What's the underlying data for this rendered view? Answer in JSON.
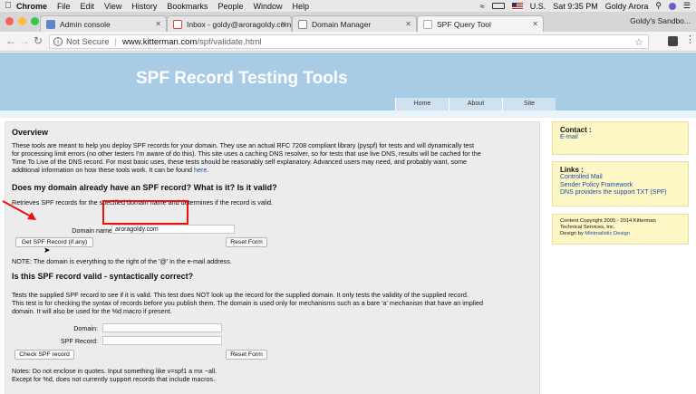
{
  "menubar": {
    "app": "Chrome",
    "menus": [
      "File",
      "Edit",
      "View",
      "History",
      "Bookmarks",
      "People",
      "Window",
      "Help"
    ],
    "input_source": "U.S.",
    "clock": "Sat 9:35 PM",
    "user": "Goldy Arora"
  },
  "tabs": [
    {
      "label": "Admin console",
      "icon_color": "#5f86c9"
    },
    {
      "label": "Inbox - goldy@aroragoldy.com",
      "icon_color": "#d44638"
    },
    {
      "label": "Domain Manager",
      "icon_color": "#4a4a4a"
    },
    {
      "label": "SPF Query Tool",
      "icon_color": "#ffffff"
    }
  ],
  "profile_label": "Goldy's Sandbo...",
  "address": {
    "security": "Not Secure",
    "domain": "www.kitterman.com",
    "path": "/spf/validate.html"
  },
  "site": {
    "title": "SPF Record Testing Tools",
    "nav": [
      "Home",
      "About",
      "Site"
    ]
  },
  "overview": {
    "heading": "Overview",
    "line1": "These tools are meant to help you deploy SPF records for your domain. They use an actual RFC 7208 compliant library (pyspf) for tests and will dynamically test",
    "line2": "for processing limit errors (no other testers I'm aware of do this). This site uses a caching DNS resolver, so for tests that use live DNS, results will be cached for the",
    "line3": "Time To Live of the DNS record. For most basic uses, these tests should be reasonably self explanatory. Advanced users may need, and probably want, some",
    "line4_prefix": "additional information on how these tools work. It can be found ",
    "line4_link": "here",
    "line4_suffix": "."
  },
  "section1": {
    "heading": "Does my domain already have an SPF record? What is it? Is it valid?",
    "desc": "Retrieves SPF records for the specified domain name and determines if the record is valid.",
    "domain_label": "Domain name:",
    "domain_value": "aroragoldy.com",
    "get_button": "Get SPF Record (if any)",
    "reset_button": "Reset Form",
    "note": "NOTE: The domain is everything to the right of the '@' in the e-mail address."
  },
  "section2": {
    "heading": "Is this SPF record valid - syntactically correct?",
    "desc1": "Tests the supplied SPF record to see if it is valid. This test does NOT look up the record for the supplied domain. It only tests the validity of the supplied record.",
    "desc2": "This test is for checking the syntax of records before you publish them. The domain is used only for mechanisms such as a bare 'a' mechanism that have an implied",
    "desc3": "domain. It will also be used for the %d macro if present.",
    "domain_label": "Domain:",
    "domain_value": "",
    "record_label": "SPF Record:",
    "record_value": "",
    "check_button": "Check SPF record",
    "reset_button": "Reset Form",
    "note1": "Notes: Do not enclose in quotes. Input something like v=spf1 a mx ~all.",
    "note2": "Except for %d, does not currently support records that include macros."
  },
  "sidebar": {
    "contact_heading": "Contact :",
    "contact_link": "E-mail",
    "links_heading": "Links :",
    "links": [
      "Controlled Mail",
      "Sender Policy Framework",
      "DNS providers the support TXT (SPF)"
    ],
    "copyright1": "Content Copyright 2005 - 2014 Kitterman",
    "copyright2": "Technical Services, Inc.",
    "design_prefix": "Design by ",
    "design_link": "Minimalistic Design"
  },
  "colors": {
    "banner": "#a9cce6",
    "sidebar_bg": "#fdf6c5",
    "link": "#1a4fa0",
    "annotation_red": "#e11"
  }
}
